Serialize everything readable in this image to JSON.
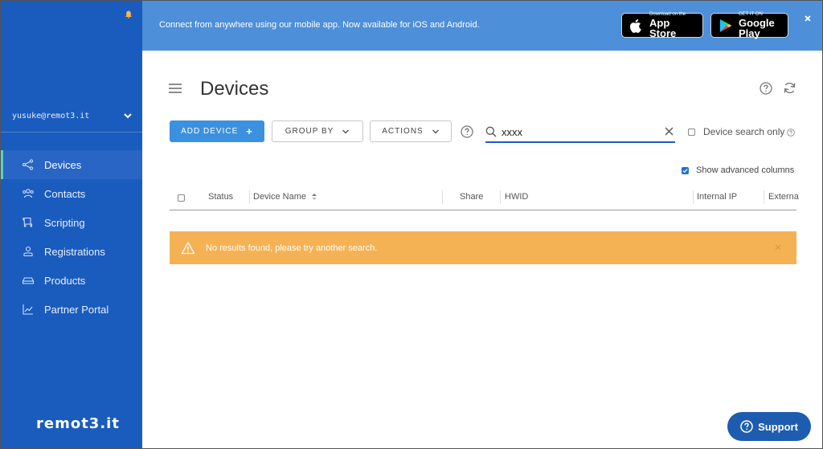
{
  "banner": {
    "text": "Connect from anywhere using our mobile app. Now available for iOS and Android.",
    "appstore_small": "Download on the",
    "appstore_big": "App Store",
    "googleplay_small": "GET IT ON",
    "googleplay_big": "Google Play"
  },
  "sidebar": {
    "account_email": "yusuke@remot3.it",
    "items": [
      {
        "label": "Devices",
        "icon": "devices-icon"
      },
      {
        "label": "Contacts",
        "icon": "contacts-icon"
      },
      {
        "label": "Scripting",
        "icon": "scripting-icon"
      },
      {
        "label": "Registrations",
        "icon": "registrations-icon"
      },
      {
        "label": "Products",
        "icon": "products-icon"
      },
      {
        "label": "Partner Portal",
        "icon": "partner-portal-icon"
      }
    ],
    "logo": "remot3.it"
  },
  "main": {
    "title": "Devices",
    "add_device": "ADD DEVICE",
    "group_by": "GROUP BY",
    "actions": "ACTIONS",
    "search_value": "xxxx",
    "device_search_only": "Device search only",
    "show_advanced_columns": "Show advanced columns",
    "columns": [
      "Status",
      "Device Name",
      "Share",
      "HWID",
      "Internal IP",
      "Externa"
    ],
    "alert": "No results found, please try another search."
  },
  "support": {
    "label": "Support"
  },
  "colors": {
    "sidebar": "#1a5cbd",
    "banner": "#4d8fd8",
    "primary_button": "#3b91e0",
    "alert": "#f5b255",
    "active_indicator": "#5fd0c1"
  }
}
